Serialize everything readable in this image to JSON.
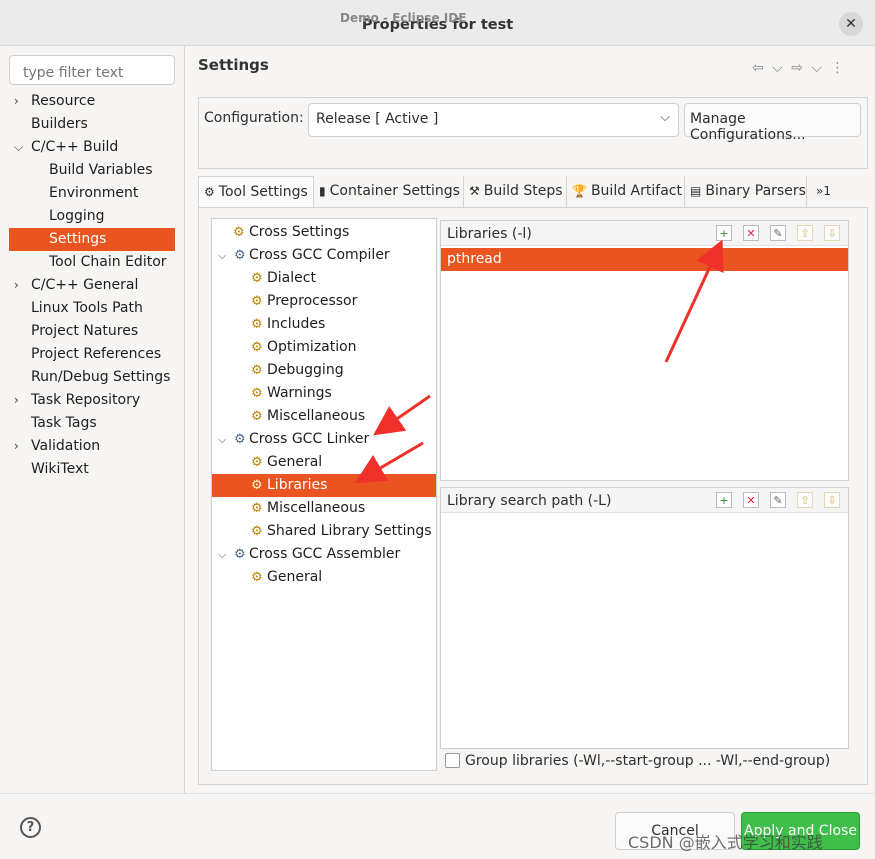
{
  "window": {
    "background_title": "Demo - Eclipse IDE",
    "title": "Properties for test",
    "close_glyph": "✕"
  },
  "filter": {
    "placeholder": "type filter text"
  },
  "nav": {
    "items": [
      {
        "label": "Resource",
        "expandable": true
      },
      {
        "label": "Builders"
      },
      {
        "label": "C/C++ Build",
        "expanded": true
      },
      {
        "label": "Build Variables",
        "child": true
      },
      {
        "label": "Environment",
        "child": true
      },
      {
        "label": "Logging",
        "child": true
      },
      {
        "label": "Settings",
        "child": true,
        "selected": true
      },
      {
        "label": "Tool Chain Editor",
        "child": true
      },
      {
        "label": "C/C++ General",
        "expandable": true
      },
      {
        "label": "Linux Tools Path"
      },
      {
        "label": "Project Natures"
      },
      {
        "label": "Project References"
      },
      {
        "label": "Run/Debug Settings"
      },
      {
        "label": "Task Repository",
        "expandable": true
      },
      {
        "label": "Task Tags"
      },
      {
        "label": "Validation",
        "expandable": true
      },
      {
        "label": "WikiText"
      }
    ]
  },
  "settings": {
    "heading": "Settings",
    "nav_icons": "⇦ ⌵ ⇨ ⌵ ⋮",
    "configuration_label": "Configuration:",
    "configuration_value": "Release  [ Active ]",
    "manage_label": "Manage Configurations..."
  },
  "tabs": [
    {
      "label": "Tool Settings",
      "icon": "gear-icon",
      "glyph": "⚙",
      "active": true
    },
    {
      "label": "Container Settings",
      "icon": "container-icon",
      "glyph": "▮"
    },
    {
      "label": "Build Steps",
      "icon": "hammer-icon",
      "glyph": "⚒"
    },
    {
      "label": "Build Artifact",
      "icon": "trophy-icon",
      "glyph": "🏆"
    },
    {
      "label": "Binary Parsers",
      "icon": "binary-icon",
      "glyph": "▤"
    }
  ],
  "tabs_overflow": "»1",
  "tree": {
    "nodes": [
      {
        "label": "Cross Settings",
        "level": 1
      },
      {
        "label": "Cross GCC Compiler",
        "level": 0
      },
      {
        "label": "Dialect",
        "level": 1
      },
      {
        "label": "Preprocessor",
        "level": 1
      },
      {
        "label": "Includes",
        "level": 1
      },
      {
        "label": "Optimization",
        "level": 1
      },
      {
        "label": "Debugging",
        "level": 1
      },
      {
        "label": "Warnings",
        "level": 1
      },
      {
        "label": "Miscellaneous",
        "level": 1
      },
      {
        "label": "Cross GCC Linker",
        "level": 0
      },
      {
        "label": "General",
        "level": 1
      },
      {
        "label": "Libraries",
        "level": 1,
        "selected": true
      },
      {
        "label": "Miscellaneous",
        "level": 1
      },
      {
        "label": "Shared Library Settings",
        "level": 1
      },
      {
        "label": "Cross GCC Assembler",
        "level": 0
      },
      {
        "label": "General",
        "level": 1
      }
    ]
  },
  "libraries": {
    "header": "Libraries (-l)",
    "items": [
      "pthread"
    ]
  },
  "search_path": {
    "header": "Library search path (-L)",
    "items": []
  },
  "group_libraries_label": "Group libraries (-Wl,--start-group  ...  -Wl,--end-group)",
  "footer": {
    "help": "?",
    "cancel": "Cancel",
    "apply": "Apply and Close"
  },
  "watermark": "CSDN @嵌入式学习和实践",
  "colors": {
    "selection": "#e95420",
    "apply_button": "#3fbe4a",
    "annotation_arrow": "#f0302a"
  }
}
